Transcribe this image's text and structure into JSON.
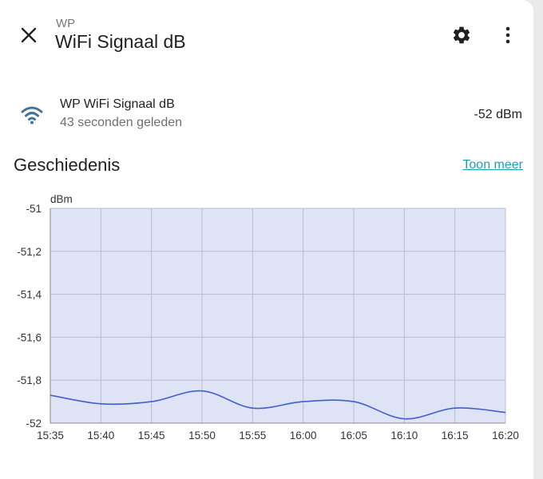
{
  "header": {
    "subtitle": "WP",
    "title": "WiFi Signaal dB",
    "icons": [
      "close-icon",
      "gear-icon",
      "more-vert-icon"
    ]
  },
  "entity": {
    "icon": "wifi-icon",
    "name": "WP WiFi Signaal dB",
    "last_changed": "43 seconden geleden",
    "state": "-52 dBm"
  },
  "history": {
    "heading": "Geschiedenis",
    "show_more": "Toon meer"
  },
  "colors": {
    "accent": "#1aa1b6",
    "line": "#3f5fcf",
    "area": "#dfe3f6",
    "icon_blue": "#44739e"
  },
  "chart_data": {
    "type": "line",
    "ylabel": "dBm",
    "ylim": [
      -52,
      -51
    ],
    "yticks": [
      "-51",
      "-51,2",
      "-51,4",
      "-51,6",
      "-51,8",
      "-52"
    ],
    "yticks_values": [
      -51,
      -51.2,
      -51.4,
      -51.6,
      -51.8,
      -52
    ],
    "xticks": [
      "15:35",
      "15:40",
      "15:45",
      "15:50",
      "15:55",
      "16:00",
      "16:05",
      "16:10",
      "16:15",
      "16:20"
    ],
    "xlim": [
      "15:35",
      "16:20"
    ],
    "grid": true,
    "series": [
      {
        "x": [
          "15:35",
          "15:40",
          "15:45",
          "15:50",
          "15:55",
          "16:00",
          "16:05",
          "16:10",
          "16:15",
          "16:20"
        ],
        "y": [
          -51.87,
          -51.91,
          -51.9,
          -51.85,
          -51.93,
          -51.9,
          -51.9,
          -51.98,
          -51.93,
          -51.95
        ]
      }
    ]
  }
}
